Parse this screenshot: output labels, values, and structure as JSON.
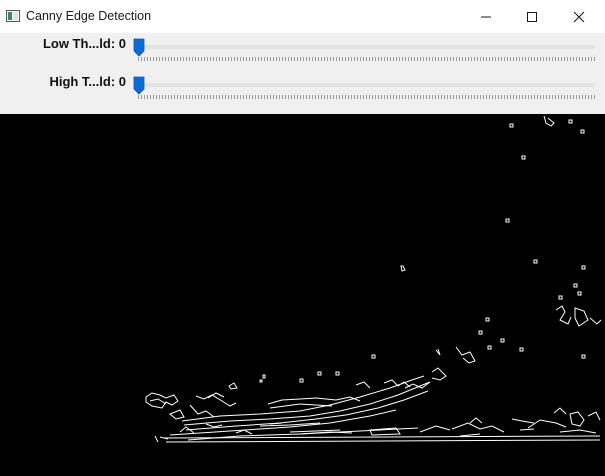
{
  "window": {
    "title": "Canny Edge Detection",
    "icon": "opencv-window-icon",
    "controls": [
      "minimize-icon",
      "maximize-icon",
      "close-icon"
    ]
  },
  "trackbars": [
    {
      "label": "Low Th...ld: 0",
      "value": 0
    },
    {
      "label": "High T...ld: 0",
      "value": 0
    }
  ],
  "colors": {
    "thumb": "#0a6cd1",
    "titlebar_bg": "#ffffff",
    "toolbar_bg": "#f0f0f0",
    "canvas_bg": "#000000",
    "edges": "#ffffff"
  }
}
